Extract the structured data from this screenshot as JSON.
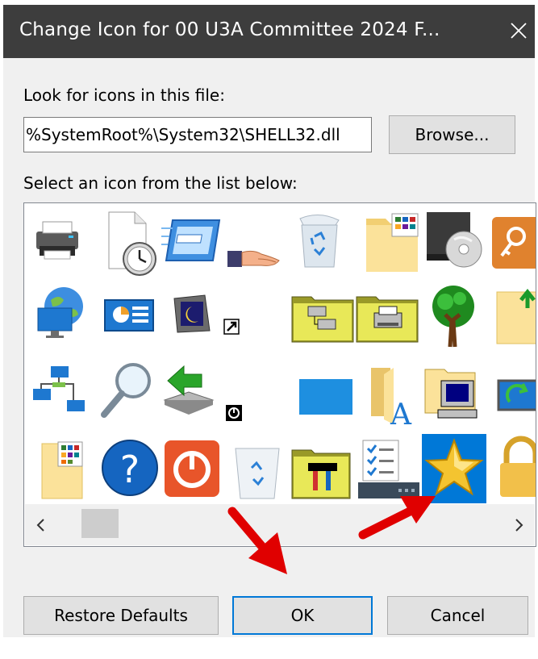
{
  "window": {
    "title": "Change Icon for 00 U3A Committee 2024 F...",
    "close_icon": "close-x-icon"
  },
  "file_section": {
    "label": "Look for icons in this file:",
    "path_value": "%SystemRoot%\\System32\\SHELL32.dll",
    "browse_label": "Browse..."
  },
  "icon_list": {
    "label": "Select an icon from the list below:",
    "icons": [
      "printer-icon",
      "document-clock-icon",
      "window-transfer-icon",
      "hand-share-icon",
      "recycle-bin-full-icon",
      "folder-tiles-icon",
      "cd-drive-icon",
      "key-icon",
      "globe-monitor-icon",
      "control-panel-icon",
      "moon-screen-icon",
      "shortcut-arrow-icon",
      "network-folder-icon",
      "printer-folder-icon",
      "tree-icon",
      "folder-up-icon",
      "network-icon",
      "magnifier-icon",
      "usb-drive-arrow-icon",
      "power-overlay-icon",
      "blue-desktop-icon",
      "folder-font-icon",
      "computer-folder-icon",
      "monitor-refresh-icon",
      "folder-tiles-2-icon",
      "help-icon",
      "power-icon",
      "recycle-bin-empty-icon",
      "tools-folder-icon",
      "checklist-server-icon",
      "star-icon",
      "lock-icon"
    ],
    "selected_icon": "star-icon"
  },
  "buttons": {
    "restore_label": "Restore Defaults",
    "ok_label": "OK",
    "cancel_label": "Cancel"
  },
  "annotations": {
    "arrow_color": "#e00000"
  }
}
